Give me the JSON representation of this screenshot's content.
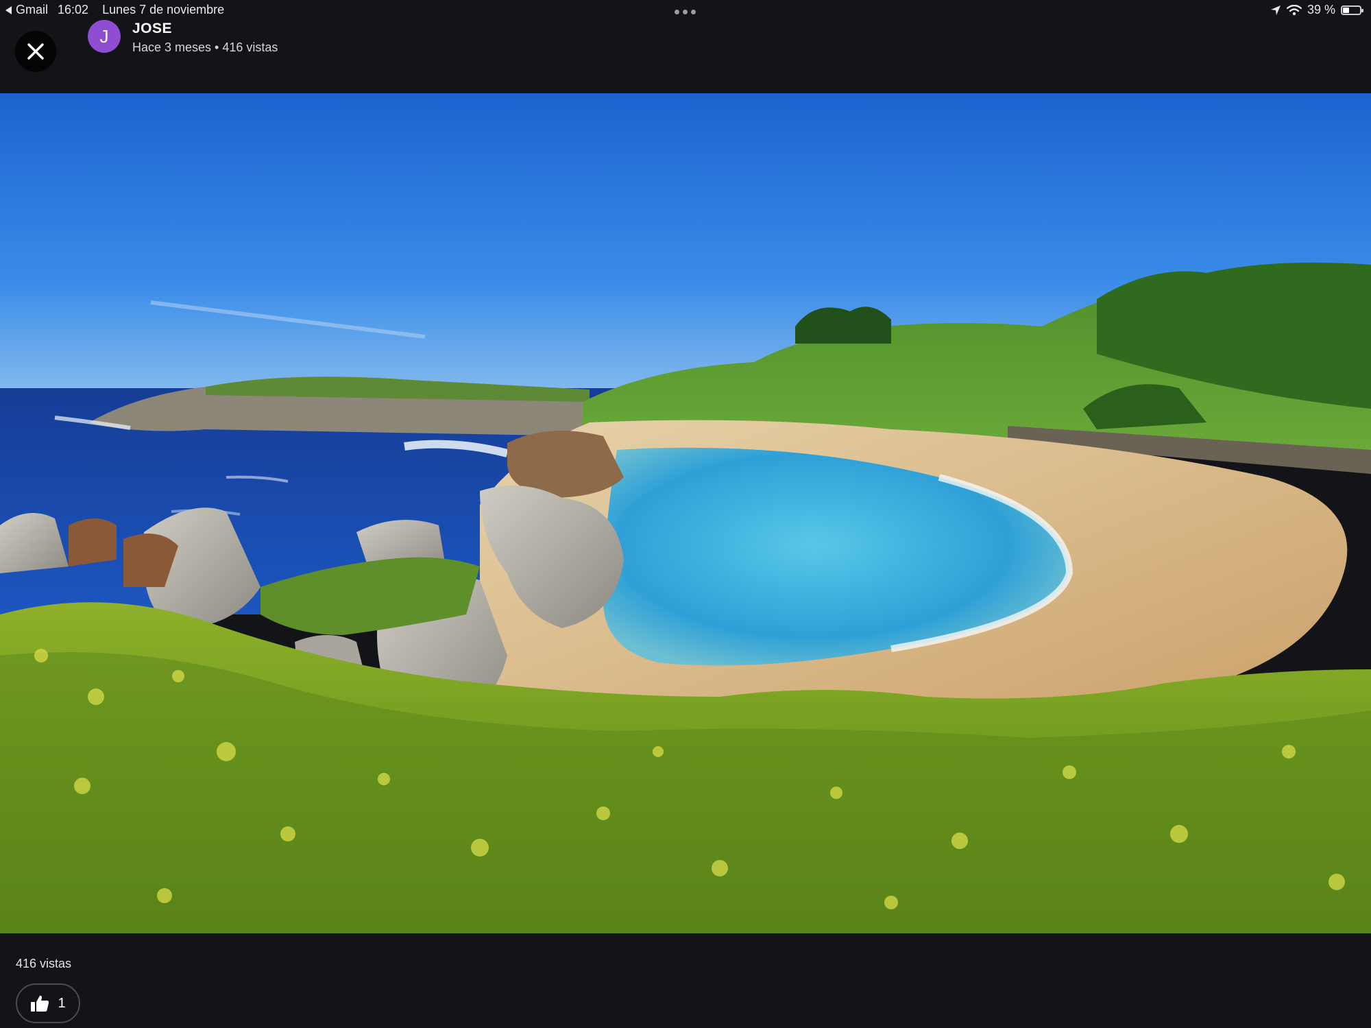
{
  "status_bar": {
    "back_app": "Gmail",
    "time": "16:02",
    "date": "Lunes 7 de noviembre",
    "battery": "39 %",
    "battery_level": 0.39
  },
  "post": {
    "author_name": "JOSE",
    "author_initial": "J",
    "meta": "Hace 3 meses • 416 vistas",
    "views": "416 vistas",
    "likes": "1"
  },
  "colors": {
    "avatar": "#8f4dd1",
    "background": "#131418"
  },
  "icons": {
    "close": "close-icon",
    "like": "thumbs-up-icon",
    "location": "location-arrow-icon",
    "wifi": "wifi-icon",
    "battery": "battery-icon",
    "back": "back-arrow-icon"
  }
}
